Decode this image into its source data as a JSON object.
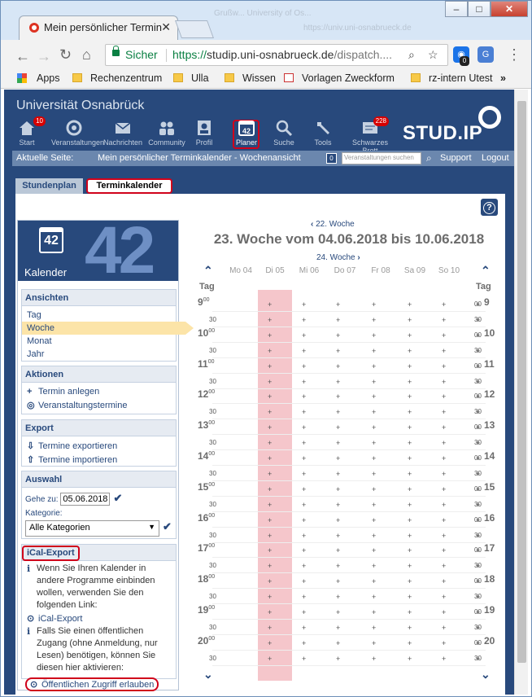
{
  "browser": {
    "tab_title": "Mein persönlicher Termin",
    "ghost_tab": "Grußw... University of Os...",
    "ghost_tab2": "https://univ.uni-osnabrueck.de",
    "security_label": "Sicher",
    "url_scheme": "https://",
    "url_host": "studip.uni-osnabrueck.de",
    "url_path": "/dispatch....",
    "ext_badge": "0",
    "bookmarks": [
      "Apps",
      "Rechenzentrum",
      "Ulla",
      "Wissen",
      "Vorlagen Zweckform",
      "rz-intern Utest"
    ],
    "more": "»"
  },
  "header": {
    "university": "Universität Osnabrück",
    "logo": "STUD.IP",
    "nav": [
      {
        "label": "Start",
        "badge": "10"
      },
      {
        "label": "Veranstaltungen",
        "badge": ""
      },
      {
        "label": "Nachrichten",
        "badge": ""
      },
      {
        "label": "Community",
        "badge": ""
      },
      {
        "label": "Profil",
        "badge": ""
      },
      {
        "label": "Planer",
        "badge": ""
      },
      {
        "label": "Suche",
        "badge": ""
      },
      {
        "label": "Tools",
        "badge": ""
      },
      {
        "label": "Schwarzes Brett",
        "badge": "228"
      }
    ],
    "planer_icon_number": "42"
  },
  "current_page": {
    "label": "Aktuelle Seite:",
    "title": "Mein persönlicher Terminkalender - Wochenansicht",
    "count": "0",
    "search_placeholder": "Veranstaltungen suchen",
    "support": "Support",
    "logout": "Logout"
  },
  "subtabs": [
    "Stundenplan",
    "Terminkalender"
  ],
  "help": "?",
  "sidebar": {
    "icon_number": "42",
    "big_number": "42",
    "title": "Kalender",
    "views_title": "Ansichten",
    "views": [
      "Tag",
      "Woche",
      "Monat",
      "Jahr"
    ],
    "actions_title": "Aktionen",
    "actions": [
      "Termin anlegen",
      "Veranstaltungstermine"
    ],
    "export_title": "Export",
    "exports": [
      "Termine exportieren",
      "Termine importieren"
    ],
    "choice_title": "Auswahl",
    "goto_label": "Gehe zu:",
    "goto_value": "05.06.2018",
    "category_label": "Kategorie:",
    "category_value": "Alle Kategorien",
    "ical_title": "iCal-Export",
    "ical_text1": "Wenn Sie Ihren Kalender in andere Programme einbinden wollen, verwenden Sie den folgenden Link:",
    "ical_link": "iCal-Export",
    "ical_text2": "Falls Sie einen öffentlichen Zugang (ohne Anmeldung, nur Lesen) benötigen, können Sie diesen hier aktivieren:",
    "public_link": "Öffentlichen Zugriff erlauben"
  },
  "calendar": {
    "prev_week": "22. Woche",
    "week_title": "23. Woche vom 04.06.2018 bis 10.06.2018",
    "next_week": "24. Woche",
    "tag_label": "Tag",
    "days": [
      "Mo 04",
      "Di 05",
      "Mi 06",
      "Do 07",
      "Fr 08",
      "Sa 09",
      "So 10"
    ],
    "today_index": 1,
    "hours": [
      "9",
      "10",
      "11",
      "12",
      "13",
      "14",
      "15",
      "16",
      "17",
      "18",
      "19",
      "20"
    ],
    "min_full": "00",
    "min_half": "30",
    "plus": "+"
  }
}
